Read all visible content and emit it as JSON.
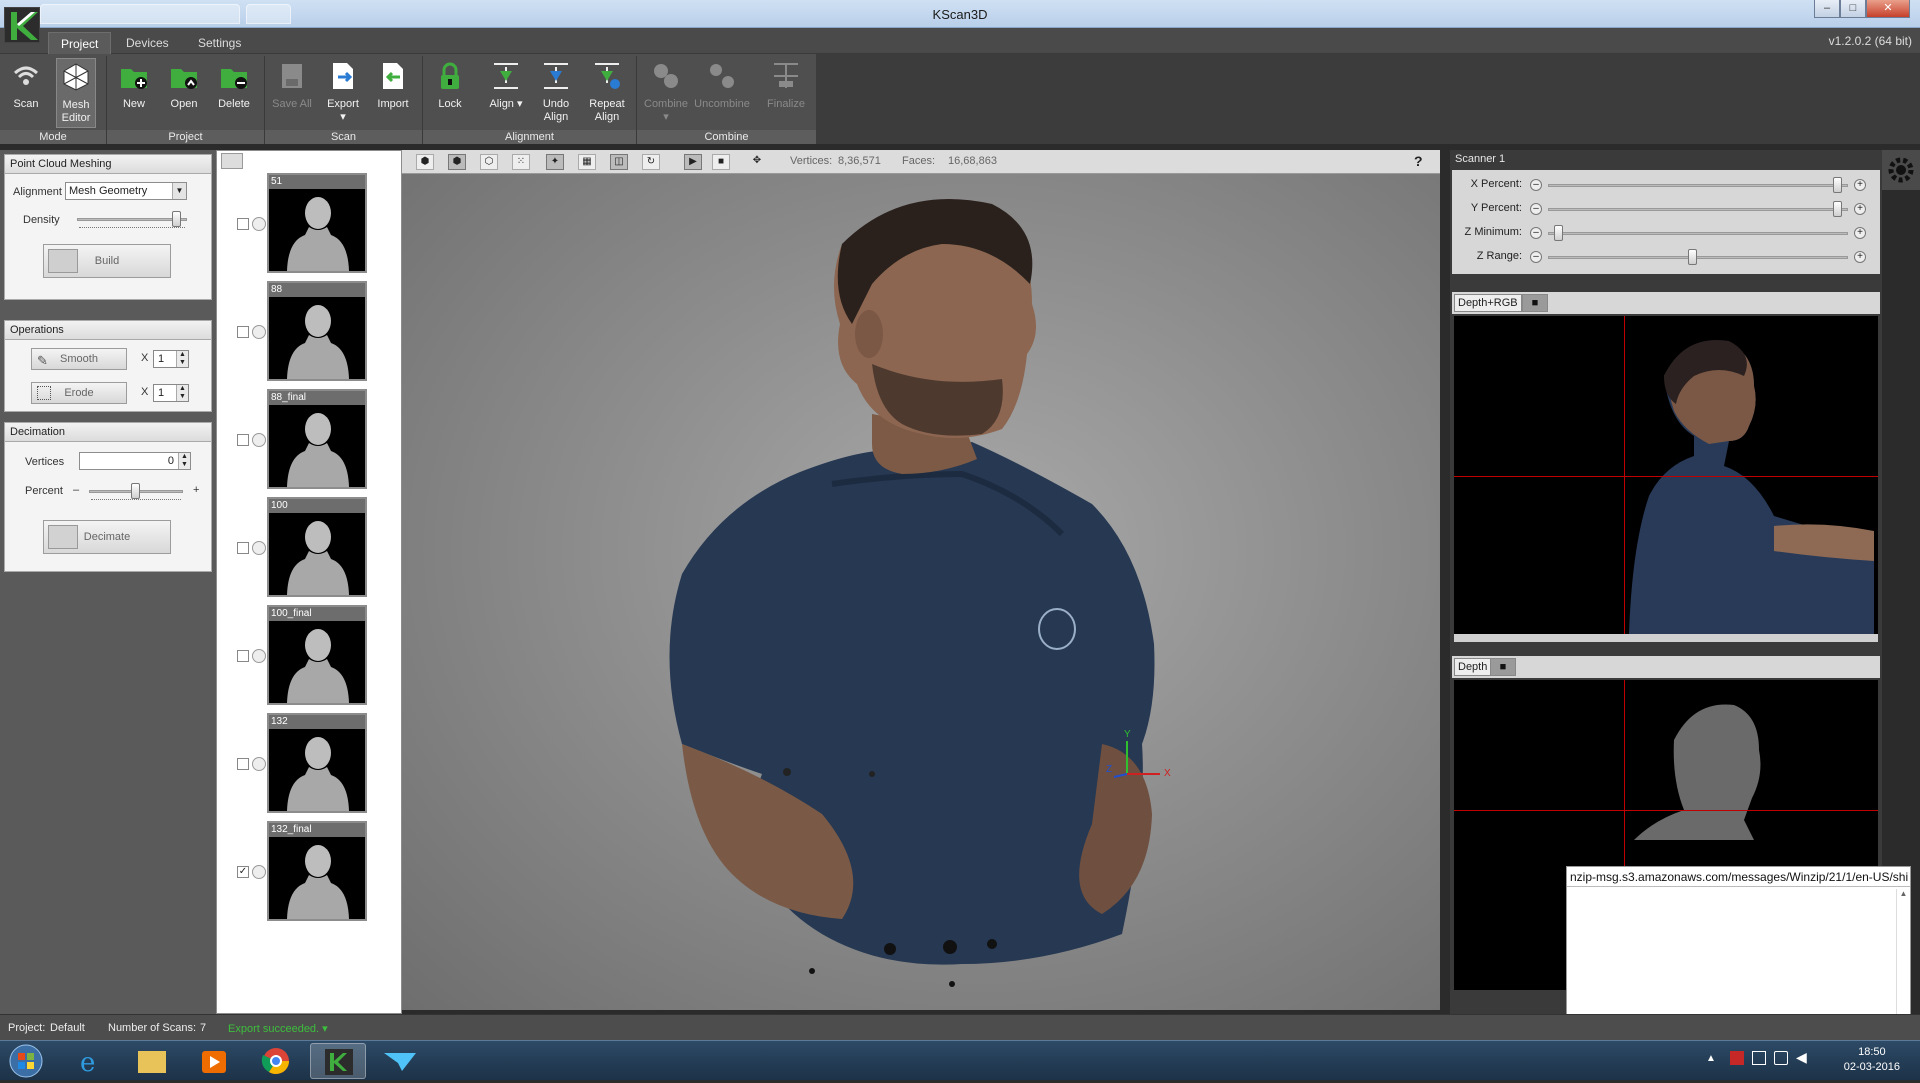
{
  "window": {
    "title": "KScan3D",
    "version": "v1.2.0.2  (64 bit)",
    "controls": [
      "–",
      "□",
      "✕"
    ]
  },
  "menu_tabs": [
    {
      "label": "Project",
      "active": true
    },
    {
      "label": "Devices",
      "active": false
    },
    {
      "label": "Settings",
      "active": false
    }
  ],
  "ribbon": {
    "mode": {
      "label": "Mode",
      "scan": "Scan",
      "mesh_editor_1": "Mesh",
      "mesh_editor_2": "Editor"
    },
    "project": {
      "label": "Project",
      "new": "New",
      "open": "Open",
      "delete": "Delete"
    },
    "scan": {
      "label": "Scan",
      "save_all": "Save All",
      "export": "Export",
      "import": "Import"
    },
    "alignment": {
      "label": "Alignment",
      "lock": "Lock",
      "align": "Align ▾",
      "undo_1": "Undo",
      "undo_2": "Align",
      "repeat_1": "Repeat",
      "repeat_2": "Align"
    },
    "combine": {
      "label": "Combine",
      "combine": "Combine",
      "uncombine": "Uncombine",
      "finalize": "Finalize"
    }
  },
  "left_panel": {
    "point_cloud": {
      "title": "Point Cloud Meshing",
      "alignment_label": "Alignment",
      "alignment_value": "Mesh Geometry",
      "density_label": "Density",
      "build": "Build"
    },
    "operations": {
      "title": "Operations",
      "smooth": "Smooth",
      "erode": "Erode",
      "x": "X",
      "smooth_count": "1",
      "erode_count": "1"
    },
    "decimation": {
      "title": "Decimation",
      "vertices_label": "Vertices",
      "vertices_value": "0",
      "percent_label": "Percent",
      "minus": "–",
      "plus": "+",
      "decimate": "Decimate"
    }
  },
  "scans": [
    {
      "name": "51",
      "checked": false
    },
    {
      "name": "88",
      "checked": false
    },
    {
      "name": "88_final",
      "checked": false
    },
    {
      "name": "100",
      "checked": false
    },
    {
      "name": "100_final",
      "checked": false
    },
    {
      "name": "132",
      "checked": false
    },
    {
      "name": "132_final",
      "checked": true
    }
  ],
  "viewport": {
    "vertices_label": "Vertices:",
    "vertices_value": "8,36,571",
    "faces_label": "Faces:",
    "faces_value": "16,68,863",
    "help": "?",
    "axis_x": "X",
    "axis_y": "Y",
    "axis_z": "Z"
  },
  "scanner": {
    "title": "Scanner 1",
    "sliders": [
      {
        "label": "X Percent:",
        "level": 0.98
      },
      {
        "label": "Y Percent:",
        "level": 0.98
      },
      {
        "label": "Z Minimum:",
        "level": 0.02
      },
      {
        "label": "Z Range:",
        "level": 0.48
      }
    ],
    "view1_label": "Depth+RGB",
    "view2_label": "Depth"
  },
  "popup": {
    "url": "nzip-msg.s3.amazonaws.com/messages/Winzip/21/1/en-US/shi"
  },
  "status": {
    "project_label": "Project:",
    "project_value": "Default",
    "scans_label": "Number of Scans:",
    "scans_value": "7",
    "message": "Export succeeded. ▾"
  },
  "taskbar": {
    "time": "18:50",
    "date": "02-03-2016"
  },
  "colors": {
    "accent_green": "#3fae3f",
    "status_ok": "#3cbf3c",
    "crosshair": "#c00000"
  }
}
